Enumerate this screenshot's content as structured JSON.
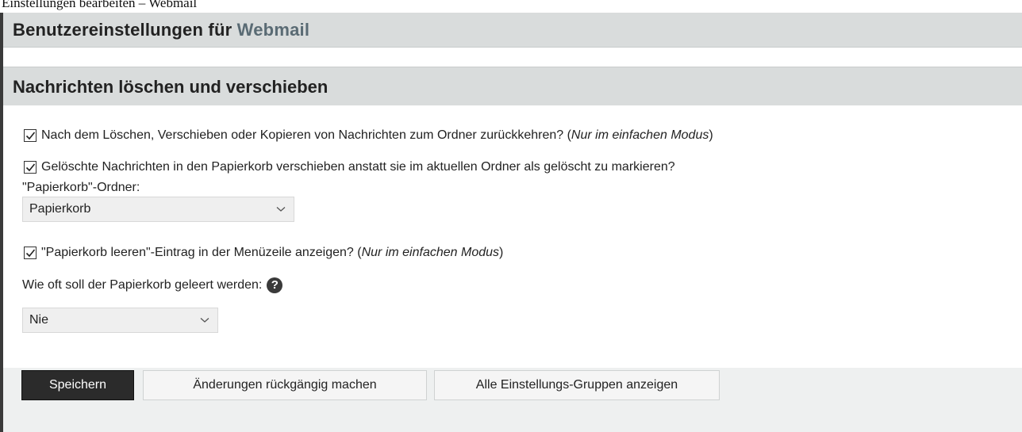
{
  "top_strip": {
    "cut_text": "Einstellungen bearbeiten – Webmail"
  },
  "header": {
    "title_prefix": "Benutzereinstellungen für",
    "title_app": "Webmail"
  },
  "section": {
    "title": "Nachrichten löschen und verschieben"
  },
  "options": {
    "return_to_folder": {
      "label": "Nach dem Löschen, Verschieben oder Kopieren von Nachrichten zum Ordner zurückkehren? (",
      "note": "Nur im einfachen Modus",
      "close": ")",
      "checked": true
    },
    "move_to_trash": {
      "label": "Gelöschte Nachrichten in den Papierkorb verschieben anstatt sie im aktuellen Ordner als gelöscht zu markieren?",
      "checked": true
    },
    "trash_folder": {
      "label": "\"Papierkorb\"-Ordner:",
      "selected": "Papierkorb"
    },
    "empty_trash_menu": {
      "label": "\"Papierkorb leeren\"-Eintrag in der Menüzeile anzeigen? (",
      "note": "Nur im einfachen Modus",
      "close": ")",
      "checked": true
    },
    "purge_frequency": {
      "label": "Wie oft soll der Papierkorb geleert werden:",
      "selected": "Nie",
      "help_icon": "question-circle-icon"
    }
  },
  "buttons": {
    "save": "Speichern",
    "undo": "Änderungen rückgängig machen",
    "all_groups": "Alle Einstellungs-Gruppen anzeigen"
  },
  "colors": {
    "header_bg": "#d9dcdc",
    "app_accent": "#5a6b74",
    "primary_button": "#2b2b2b",
    "footer_bg": "#eef0f0"
  }
}
